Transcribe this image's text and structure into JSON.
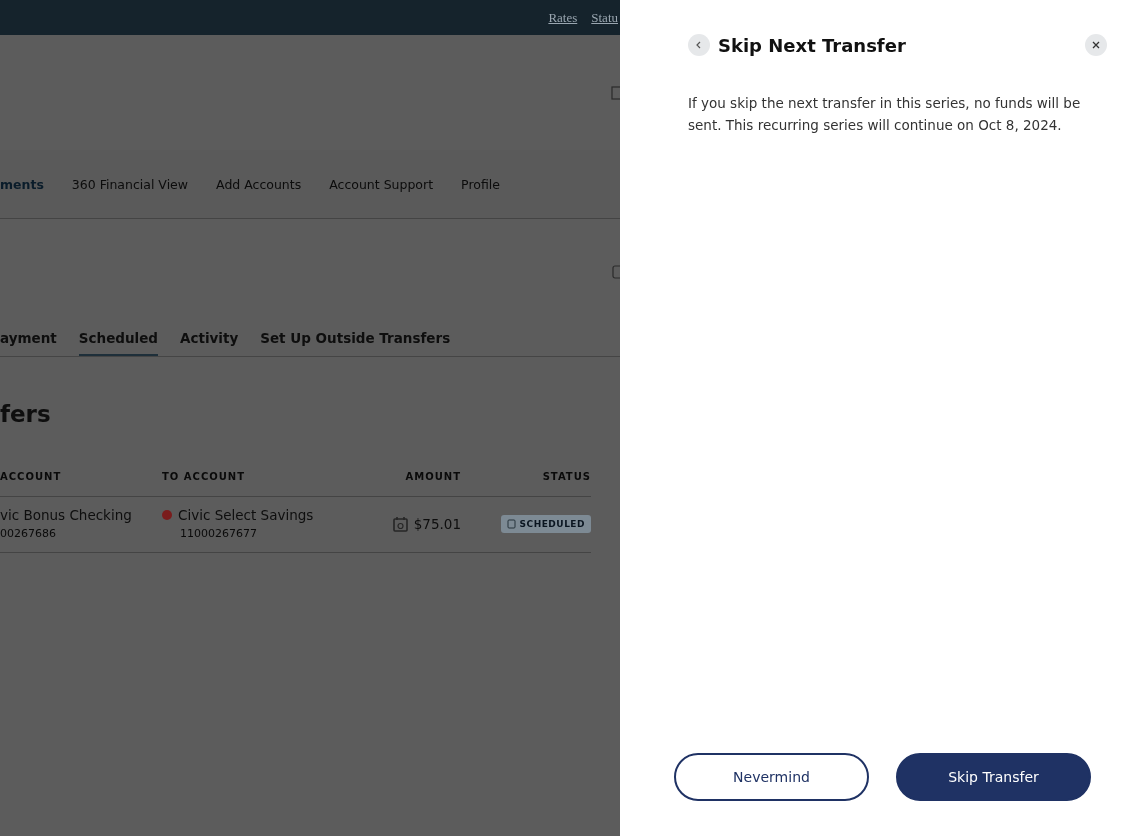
{
  "top_bar": {
    "links": [
      "Rates",
      "Statu"
    ]
  },
  "main_nav": {
    "items": [
      {
        "label": "ments",
        "selected": true
      },
      {
        "label": "360 Financial View",
        "selected": false
      },
      {
        "label": "Add Accounts",
        "selected": false
      },
      {
        "label": "Account Support",
        "selected": false
      },
      {
        "label": "Profile",
        "selected": false
      }
    ]
  },
  "tabs": [
    {
      "label": "ayment",
      "selected": false
    },
    {
      "label": "Scheduled",
      "selected": true
    },
    {
      "label": "Activity",
      "selected": false
    },
    {
      "label": "Set Up Outside Transfers",
      "selected": false
    }
  ],
  "section_title": "fers",
  "table": {
    "columns": [
      "ACCOUNT",
      "TO ACCOUNT",
      "AMOUNT",
      "STATUS"
    ],
    "rows": [
      {
        "from_name": "vic Bonus Checking",
        "from_number": "00267686",
        "to_name": "Civic Select Savings",
        "to_number": "11000267677",
        "color": "#7a1c1c",
        "amount": "$75.01",
        "status": "SCHEDULED"
      }
    ]
  },
  "panel": {
    "title": "Skip Next Transfer",
    "message": "If you skip the next transfer in this series, no funds will be sent. This recurring series will continue on Oct 8, 2024.",
    "buttons": [
      {
        "label": "Nevermind",
        "kind": "secondary"
      },
      {
        "label": "Skip Transfer",
        "kind": "primary"
      }
    ]
  }
}
